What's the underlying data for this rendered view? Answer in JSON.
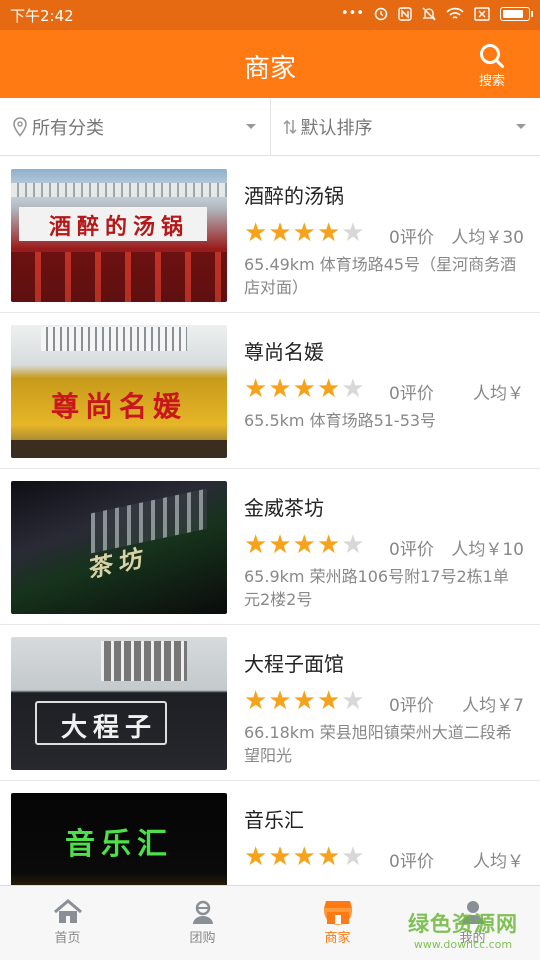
{
  "status_bar": {
    "time": "下午2:42",
    "icons": [
      "more-icon",
      "alarm-icon",
      "nfc-icon",
      "mute-icon",
      "wifi-icon",
      "sim-icon",
      "battery-icon"
    ]
  },
  "header": {
    "title": "商家",
    "search_label": "搜索"
  },
  "filters": {
    "category": {
      "label": "所有分类",
      "icon": "location-pin-icon"
    },
    "sort": {
      "label": "默认排序",
      "icon": "sort-icon"
    }
  },
  "merchants": [
    {
      "name": "酒醉的汤锅",
      "rating": 4,
      "reviews": "0评价",
      "avg": "人均￥30",
      "address": "65.49km 体育场路45号（星河商务酒店对面）",
      "image_text": "酒醉的汤锅"
    },
    {
      "name": "尊尚名媛",
      "rating": 4,
      "reviews": "0评价",
      "avg": "人均￥",
      "address": "65.5km 体育场路51-53号",
      "image_text": "尊尚名媛"
    },
    {
      "name": "金威茶坊",
      "rating": 4,
      "reviews": "0评价",
      "avg": "人均￥10",
      "address": "65.9km 荣州路106号附17号2栋1单元2楼2号",
      "image_text": "茶坊"
    },
    {
      "name": "大程子面馆",
      "rating": 4,
      "reviews": "0评价",
      "avg": "人均￥7",
      "address": "66.18km 荣县旭阳镇荣州大道二段希望阳光",
      "image_text": "大程子"
    },
    {
      "name": "音乐汇",
      "rating": 4,
      "reviews": "0评价",
      "avg": "人均￥",
      "address": "",
      "image_text": "音乐汇"
    }
  ],
  "tabs": [
    {
      "label": "首页",
      "icon": "home-icon"
    },
    {
      "label": "团购",
      "icon": "group-buy-icon"
    },
    {
      "label": "商家",
      "icon": "shop-icon",
      "active": true
    },
    {
      "label": "我的",
      "icon": "profile-icon"
    }
  ],
  "watermark": {
    "cn": "绿色资源网",
    "en": "www.downcc.com"
  },
  "colors": {
    "accent": "#ff7a12",
    "status_bar": "#e66a12",
    "star": "#f7a21b"
  }
}
